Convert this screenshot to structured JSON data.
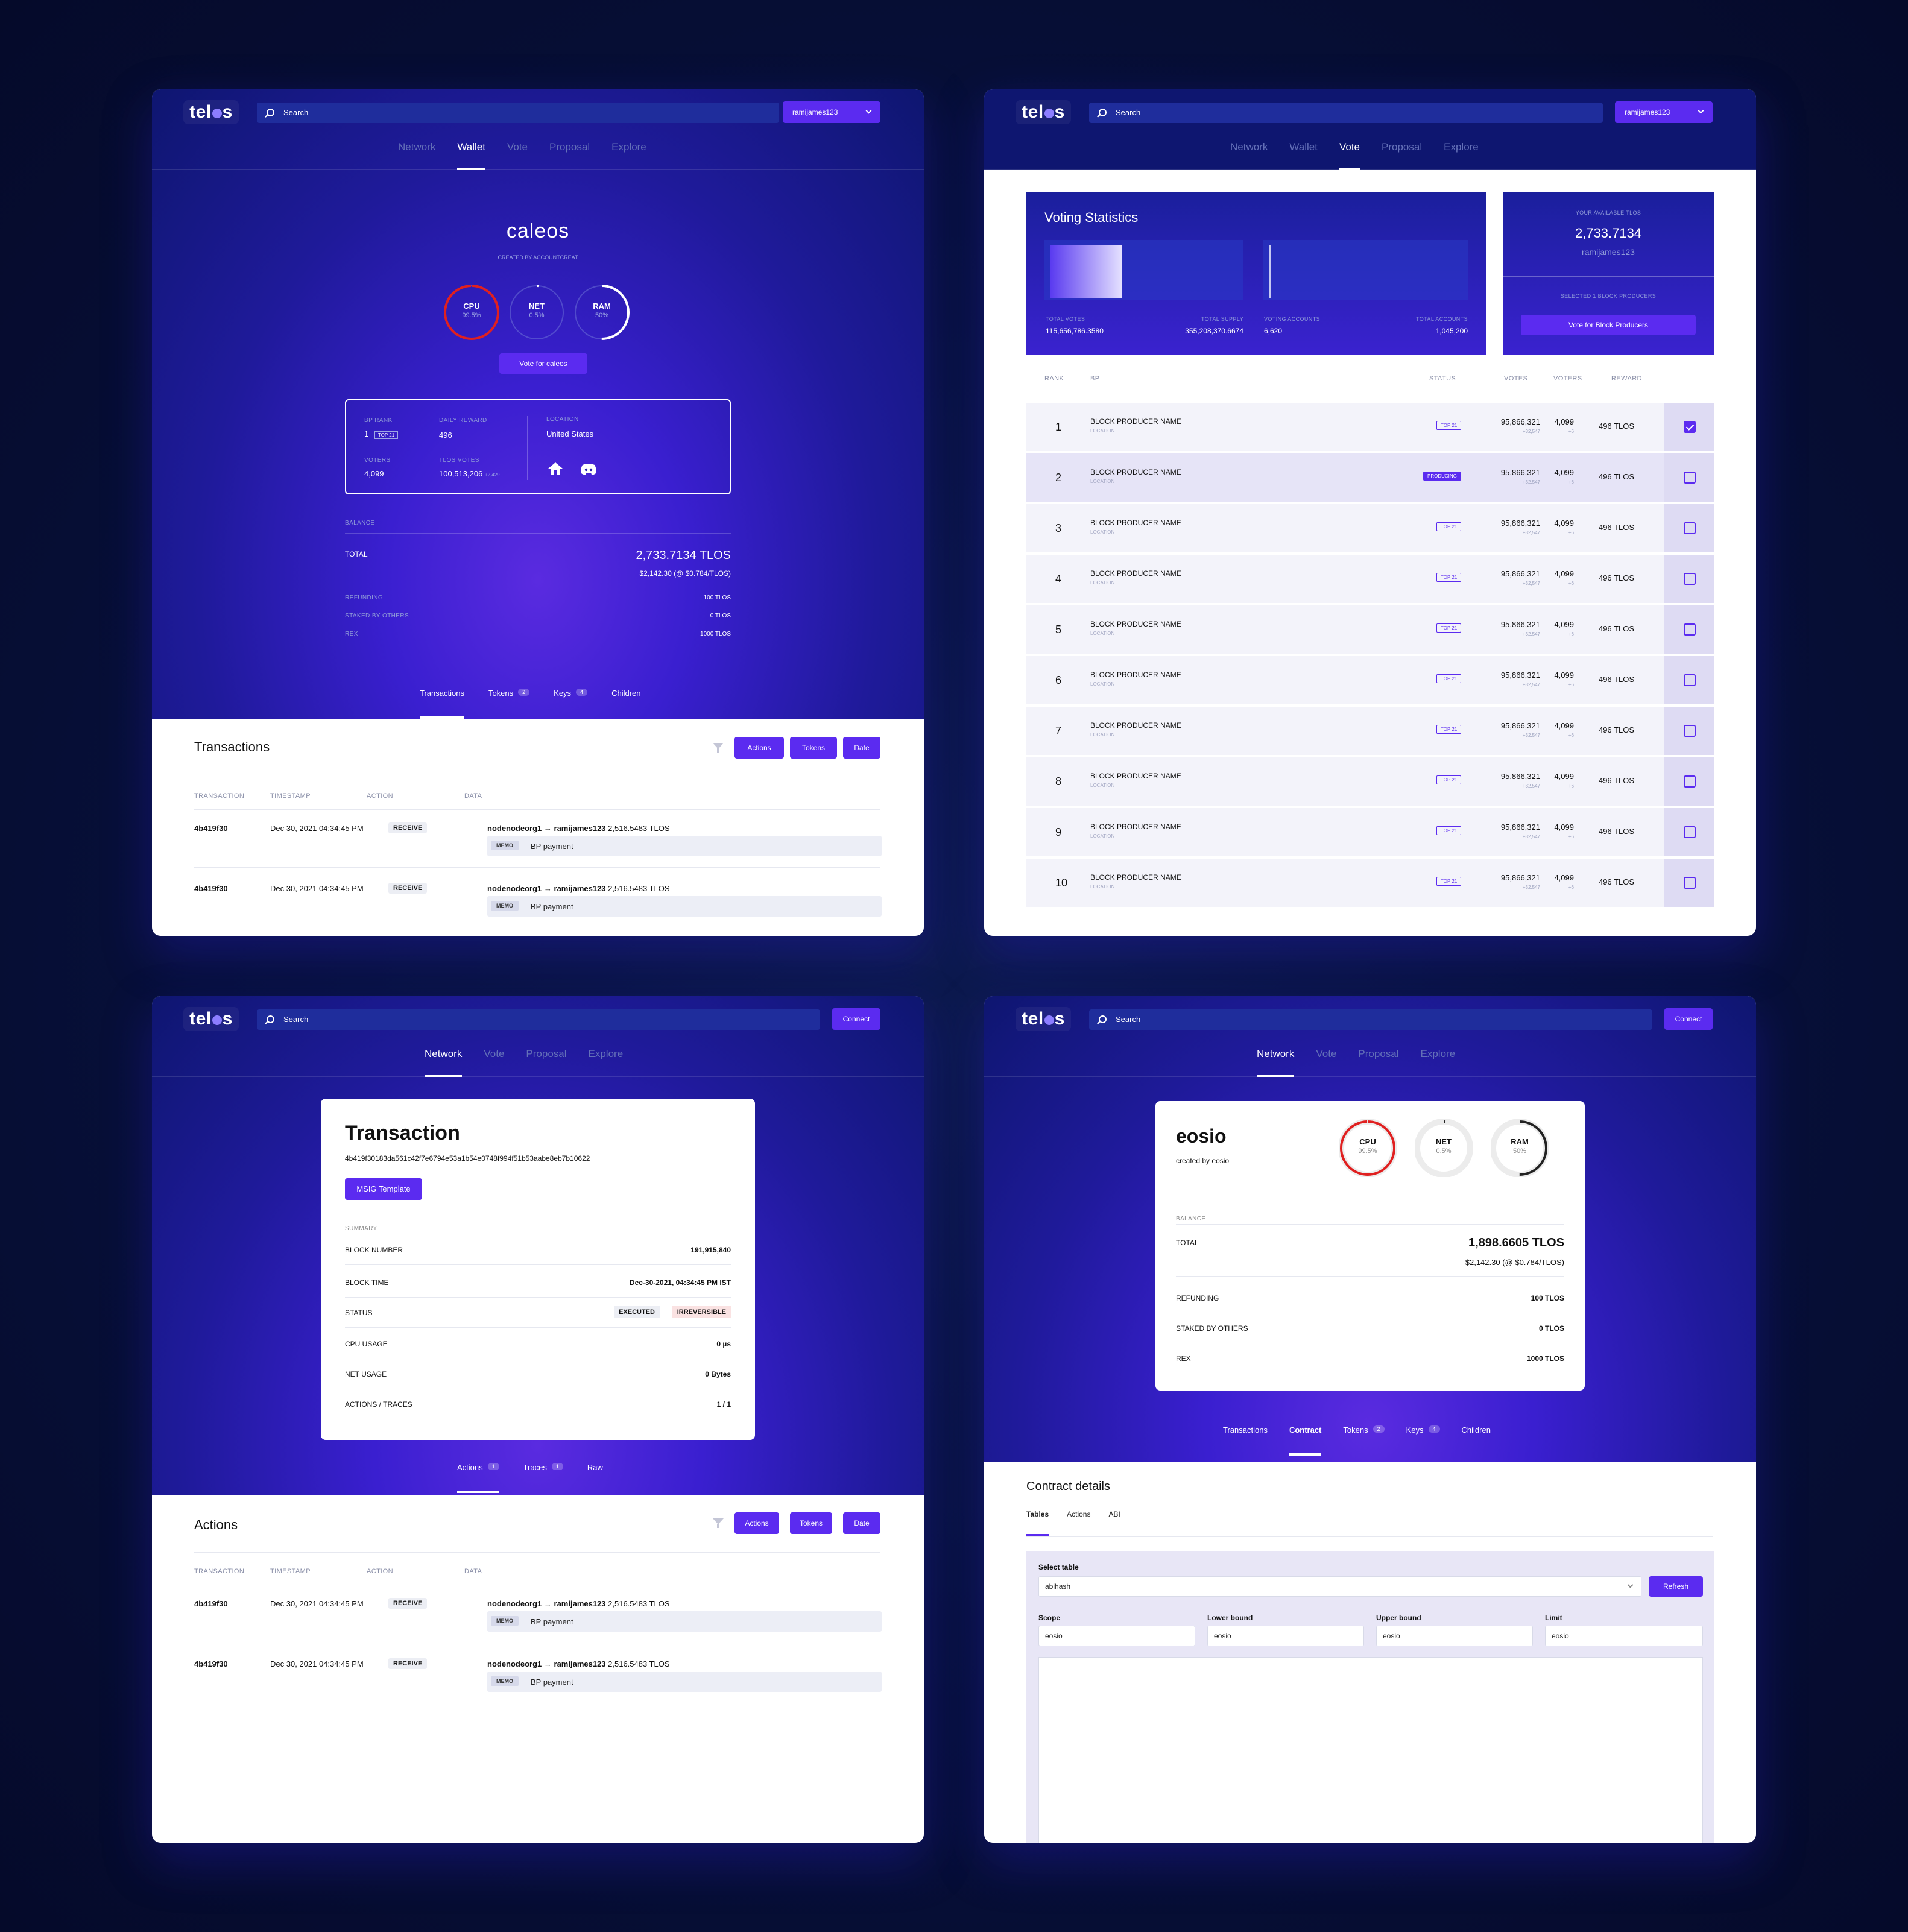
{
  "brand": {
    "logo_left": "tel",
    "logo_right": "s",
    "search_placeholder": "Search",
    "user": "ramijames123",
    "connect": "Connect"
  },
  "nav": {
    "network": "Network",
    "wallet": "Wallet",
    "vote": "Vote",
    "proposal": "Proposal",
    "explore": "Explore"
  },
  "wallet": {
    "account": "caleos",
    "created_by_label": "CREATED BY",
    "created_by": "ACCOUNTCREAT",
    "gauges": [
      {
        "label": "CPU",
        "value": "99.5%",
        "fraction": 0.995,
        "color": "#e02020"
      },
      {
        "label": "NET",
        "value": "0.5%",
        "fraction": 0.005,
        "color": "#ffffff"
      },
      {
        "label": "RAM",
        "value": "50%",
        "fraction": 0.5,
        "color": "#ffffff"
      }
    ],
    "vote_button": "Vote for caleos",
    "bp": {
      "rank_label": "BP RANK",
      "rank": "1",
      "rank_tag": "TOP 21",
      "reward_label": "DAILY REWARD",
      "reward": "496",
      "voters_label": "VOTERS",
      "voters": "4,099",
      "tlos_votes_label": "TLOS VOTES",
      "tlos_votes": "100,513,206",
      "tlos_votes_delta": "+2,429",
      "location_label": "LOCATION",
      "location": "United States"
    },
    "balance": {
      "label": "BALANCE",
      "total_label": "TOTAL",
      "total": "2,733.7134 TLOS",
      "usd": "$2,142.30 (@ $0.784/TLOS)",
      "refunding_label": "REFUNDING",
      "refunding": "100 TLOS",
      "staked_label": "STAKED BY OTHERS",
      "staked": "0 TLOS",
      "rex_label": "REX",
      "rex": "1000 TLOS"
    },
    "subtabs": [
      {
        "label": "Transactions",
        "count": ""
      },
      {
        "label": "Tokens",
        "count": "2"
      },
      {
        "label": "Keys",
        "count": "4"
      },
      {
        "label": "Children",
        "count": ""
      }
    ],
    "section_title": "Transactions",
    "filters": [
      "Actions",
      "Tokens",
      "Date"
    ],
    "columns": [
      "TRANSACTION",
      "TIMESTAMP",
      "ACTION",
      "DATA"
    ],
    "rows": [
      {
        "tx": "4b419f30",
        "time": "Dec 30, 2021 04:34:45 PM",
        "action": "RECEIVE",
        "from": "nodenodeorg1",
        "to": "ramijames123",
        "amount": "2,516.5483 TLOS",
        "memo_tag": "MEMO",
        "memo": "BP payment"
      },
      {
        "tx": "4b419f30",
        "time": "Dec 30, 2021 04:34:45 PM",
        "action": "RECEIVE",
        "from": "nodenodeorg1",
        "to": "ramijames123",
        "amount": "2,516.5483 TLOS",
        "memo_tag": "MEMO",
        "memo": "BP payment"
      }
    ]
  },
  "vote": {
    "stats_title": "Voting Statistics",
    "total_votes_label": "TOTAL VOTES",
    "total_votes": "115,656,786.3580",
    "total_supply_label": "TOTAL SUPPLY",
    "total_supply": "355,208,370.6674",
    "voting_accounts_label": "VOTING ACCOUNTS",
    "voting_accounts": "6,620",
    "total_accounts_label": "TOTAL ACCOUNTS",
    "total_accounts": "1,045,200",
    "vote_share_fraction": 0.33,
    "accounts_share_fraction": 0.006,
    "available_label": "YOUR AVAILABLE TLOS",
    "available": "2,733.7134",
    "available_account": "ramijames123",
    "selected_label": "SELECTED 1 BLOCK PRODUCERS",
    "vote_button": "Vote for Block Producers",
    "columns": {
      "rank": "RANK",
      "bp": "BP",
      "status": "STATUS",
      "votes": "VOTES",
      "voters": "VOTERS",
      "reward": "REWARD"
    },
    "rows": [
      {
        "rank": "1",
        "name": "BLOCK PRODUCER NAME",
        "loc": "LOCATION",
        "status": "TOP 21",
        "producing": false,
        "votes": "95,866,321",
        "votes_delta": "+32,547",
        "voters": "4,099",
        "voters_delta": "+6",
        "reward": "496 TLOS",
        "checked": true
      },
      {
        "rank": "2",
        "name": "BLOCK PRODUCER NAME",
        "loc": "LOCATION",
        "status": "PRODUCING",
        "producing": true,
        "votes": "95,866,321",
        "votes_delta": "+32,547",
        "voters": "4,099",
        "voters_delta": "+6",
        "reward": "496 TLOS",
        "checked": false
      },
      {
        "rank": "3",
        "name": "BLOCK PRODUCER NAME",
        "loc": "LOCATION",
        "status": "TOP 21",
        "producing": false,
        "votes": "95,866,321",
        "votes_delta": "+32,547",
        "voters": "4,099",
        "voters_delta": "+6",
        "reward": "496 TLOS",
        "checked": false
      },
      {
        "rank": "4",
        "name": "BLOCK PRODUCER NAME",
        "loc": "LOCATION",
        "status": "TOP 21",
        "producing": false,
        "votes": "95,866,321",
        "votes_delta": "+32,547",
        "voters": "4,099",
        "voters_delta": "+6",
        "reward": "496 TLOS",
        "checked": false
      },
      {
        "rank": "5",
        "name": "BLOCK PRODUCER NAME",
        "loc": "LOCATION",
        "status": "TOP 21",
        "producing": false,
        "votes": "95,866,321",
        "votes_delta": "+32,547",
        "voters": "4,099",
        "voters_delta": "+6",
        "reward": "496 TLOS",
        "checked": false
      },
      {
        "rank": "6",
        "name": "BLOCK PRODUCER NAME",
        "loc": "LOCATION",
        "status": "TOP 21",
        "producing": false,
        "votes": "95,866,321",
        "votes_delta": "+32,547",
        "voters": "4,099",
        "voters_delta": "+6",
        "reward": "496 TLOS",
        "checked": false
      },
      {
        "rank": "7",
        "name": "BLOCK PRODUCER NAME",
        "loc": "LOCATION",
        "status": "TOP 21",
        "producing": false,
        "votes": "95,866,321",
        "votes_delta": "+32,547",
        "voters": "4,099",
        "voters_delta": "+6",
        "reward": "496 TLOS",
        "checked": false
      },
      {
        "rank": "8",
        "name": "BLOCK PRODUCER NAME",
        "loc": "LOCATION",
        "status": "TOP 21",
        "producing": false,
        "votes": "95,866,321",
        "votes_delta": "+32,547",
        "voters": "4,099",
        "voters_delta": "+6",
        "reward": "496 TLOS",
        "checked": false
      },
      {
        "rank": "9",
        "name": "BLOCK PRODUCER NAME",
        "loc": "LOCATION",
        "status": "TOP 21",
        "producing": false,
        "votes": "95,866,321",
        "votes_delta": "+32,547",
        "voters": "4,099",
        "voters_delta": "+6",
        "reward": "496 TLOS",
        "checked": false
      },
      {
        "rank": "10",
        "name": "BLOCK PRODUCER NAME",
        "loc": "LOCATION",
        "status": "TOP 21",
        "producing": false,
        "votes": "95,866,321",
        "votes_delta": "+32,547",
        "voters": "4,099",
        "voters_delta": "+6",
        "reward": "496 TLOS",
        "checked": false
      }
    ]
  },
  "transaction": {
    "title": "Transaction",
    "hash": "4b419f30183da561c42f7e6794e53a1b54e0748f994f51b53aabe8eb7b10622",
    "msig_button": "MSIG Template",
    "summary_label": "SUMMARY",
    "block_number_label": "BLOCK NUMBER",
    "block_number": "191,915,840",
    "block_time_label": "BLOCK TIME",
    "block_time": "Dec-30-2021, 04:34:45 PM IST",
    "status_label": "STATUS",
    "status_executed": "EXECUTED",
    "status_irreversible": "IRREVERSIBLE",
    "cpu_label": "CPU USAGE",
    "cpu": "0 µs",
    "net_label": "NET USAGE",
    "net": "0 Bytes",
    "actions_label": "ACTIONS / TRACES",
    "actions": "1 / 1",
    "subtabs": [
      {
        "label": "Actions",
        "count": "1"
      },
      {
        "label": "Traces",
        "count": "1"
      },
      {
        "label": "Raw",
        "count": ""
      }
    ],
    "section_title": "Actions"
  },
  "contract": {
    "account": "eosio",
    "created_by_label": "created by",
    "created_by": "eosio",
    "gauges": [
      {
        "label": "CPU",
        "value": "99.5%",
        "fraction": 0.995,
        "color": "#e02020"
      },
      {
        "label": "NET",
        "value": "0.5%",
        "fraction": 0.005,
        "color": "#222222"
      },
      {
        "label": "RAM",
        "value": "50%",
        "fraction": 0.5,
        "color": "#222222"
      }
    ],
    "balance": {
      "label": "BALANCE",
      "total_label": "TOTAL",
      "total": "1,898.6605 TLOS",
      "usd": "$2,142.30 (@ $0.784/TLOS)",
      "refunding_label": "REFUNDING",
      "refunding": "100 TLOS",
      "staked_label": "STAKED BY OTHERS",
      "staked": "0 TLOS",
      "rex_label": "REX",
      "rex": "1000 TLOS"
    },
    "subtabs": [
      {
        "label": "Transactions",
        "count": ""
      },
      {
        "label": "Contract",
        "count": ""
      },
      {
        "label": "Tokens",
        "count": "2"
      },
      {
        "label": "Keys",
        "count": "4"
      },
      {
        "label": "Children",
        "count": ""
      }
    ],
    "section_title": "Contract details",
    "inner_tabs": [
      "Tables",
      "Actions",
      "ABI"
    ],
    "select_label": "Select table",
    "select_value": "abihash",
    "refresh": "Refresh",
    "scope_label": "Scope",
    "lower_label": "Lower bound",
    "upper_label": "Upper bound",
    "limit_label": "Limit",
    "field_value": "eosio"
  }
}
